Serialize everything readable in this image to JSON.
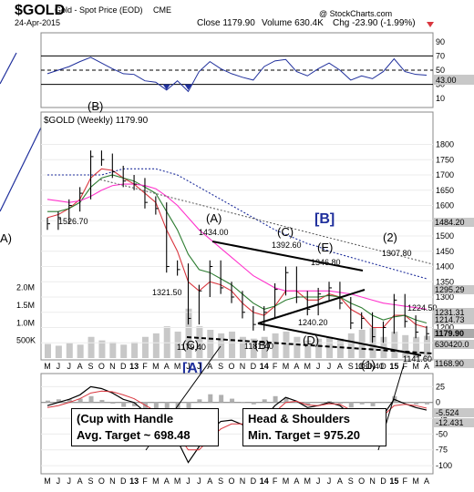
{
  "header": {
    "symbol": "$GOLD",
    "name": "Gold - Spot Price (EOD)",
    "exchange": "CME",
    "date": "24-Apr-2015",
    "close": "Close 1179.90",
    "volume": "Volume 630.4K",
    "change": "Chg -23.90 (-1.99%)",
    "watermark": "@ StockCharts.com"
  },
  "colors": {
    "price": "#000000",
    "ma_fast": "#d9363e",
    "ma_mid": "#2e7d32",
    "ma_pink": "#ff33cc",
    "ma_long": "#1f2f9c",
    "rsi": "#1f2f9c",
    "volume": "#c8c8c8",
    "label_box": "#c8c8c8"
  },
  "chart_data": [
    {
      "type": "line",
      "panel": "RSI",
      "yticks": [
        90,
        70,
        50,
        30,
        10
      ],
      "ylim": [
        0,
        100
      ],
      "levels": [
        70,
        50,
        30
      ],
      "last_value": "43.00",
      "x": [
        "2012-05",
        "2012-06",
        "2012-07",
        "2012-08",
        "2012-09",
        "2012-10",
        "2012-11",
        "2012-12",
        "2013-01",
        "2013-02",
        "2013-03",
        "2013-04",
        "2013-05",
        "2013-06",
        "2013-07",
        "2013-08",
        "2013-09",
        "2013-10",
        "2013-11",
        "2013-12",
        "2014-01",
        "2014-02",
        "2014-03",
        "2014-04",
        "2014-05",
        "2014-06",
        "2014-07",
        "2014-08",
        "2014-09",
        "2014-10",
        "2014-11",
        "2014-12",
        "2015-01",
        "2015-02",
        "2015-03",
        "2015-04"
      ],
      "values": [
        45,
        50,
        55,
        62,
        68,
        60,
        52,
        45,
        44,
        35,
        33,
        22,
        35,
        20,
        48,
        62,
        52,
        45,
        40,
        36,
        55,
        63,
        65,
        48,
        42,
        52,
        60,
        50,
        36,
        42,
        38,
        48,
        66,
        48,
        44,
        43
      ]
    },
    {
      "type": "line",
      "title": "$GOLD (Weekly) 1179.90",
      "panel": "price",
      "ylim": [
        1100,
        1900
      ],
      "yticks": [
        1800,
        1750,
        1700,
        1650,
        1600,
        1550,
        1500,
        1450,
        1400,
        1350,
        1300,
        1250,
        1200,
        1150
      ],
      "x": [
        "2012-05",
        "2012-06",
        "2012-07",
        "2012-08",
        "2012-09",
        "2012-10",
        "2012-11",
        "2012-12",
        "2013-01",
        "2013-02",
        "2013-03",
        "2013-04",
        "2013-05",
        "2013-06",
        "2013-07",
        "2013-08",
        "2013-09",
        "2013-10",
        "2013-11",
        "2013-12",
        "2014-01",
        "2014-02",
        "2014-03",
        "2014-04",
        "2014-05",
        "2014-06",
        "2014-07",
        "2014-08",
        "2014-09",
        "2014-10",
        "2014-11",
        "2014-12",
        "2015-01",
        "2015-02",
        "2015-03",
        "2015-04"
      ],
      "series": [
        {
          "values": [
            1540,
            1560,
            1600,
            1640,
            1760,
            1750,
            1710,
            1680,
            1670,
            1610,
            1590,
            1400,
            1390,
            1230,
            1320,
            1400,
            1330,
            1300,
            1250,
            1210,
            1250,
            1325,
            1380,
            1300,
            1260,
            1310,
            1330,
            1280,
            1215,
            1230,
            1170,
            1200,
            1290,
            1220,
            1185,
            1180
          ]
        },
        {
          "values": [
            1560,
            1570,
            1590,
            1620,
            1690,
            1720,
            1715,
            1690,
            1670,
            1640,
            1610,
            1520,
            1450,
            1350,
            1320,
            1350,
            1340,
            1320,
            1280,
            1250,
            1240,
            1270,
            1320,
            1320,
            1290,
            1290,
            1310,
            1300,
            1260,
            1240,
            1200,
            1200,
            1240,
            1240,
            1210,
            1200
          ]
        },
        {
          "values": [
            1580,
            1580,
            1590,
            1610,
            1660,
            1690,
            1700,
            1690,
            1680,
            1660,
            1640,
            1580,
            1520,
            1440,
            1390,
            1380,
            1360,
            1340,
            1310,
            1280,
            1260,
            1270,
            1290,
            1300,
            1300,
            1300,
            1305,
            1300,
            1280,
            1265,
            1240,
            1225,
            1235,
            1240,
            1225,
            1215
          ]
        },
        {
          "values": [
            1620,
            1615,
            1610,
            1615,
            1630,
            1650,
            1665,
            1670,
            1670,
            1665,
            1655,
            1630,
            1600,
            1560,
            1520,
            1490,
            1460,
            1430,
            1400,
            1370,
            1350,
            1330,
            1320,
            1320,
            1320,
            1320,
            1320,
            1315,
            1310,
            1300,
            1290,
            1280,
            1275,
            1270,
            1265,
            1260
          ]
        },
        {
          "values": [
            1700,
            1700,
            1700,
            1700,
            1700,
            1700,
            1710,
            1720,
            1720,
            1720,
            1720,
            1710,
            1700,
            1680,
            1660,
            1640,
            1620,
            1600,
            1580,
            1560,
            1540,
            1520,
            1505,
            1490,
            1475,
            1465,
            1450,
            1440,
            1430,
            1420,
            1410,
            1400,
            1390,
            1380,
            1370,
            1360
          ]
        }
      ],
      "price_labels": [
        "1526.70",
        "1434.00",
        "1392.60",
        "1346.80",
        "1321.50",
        "1307.80",
        "1240.20",
        "1224.50",
        "1179.40",
        "1181.40",
        "1130.40",
        "1141.60"
      ],
      "right_labels": [
        "1484.20",
        "1295.29",
        "1231.31",
        "1214.73",
        "1179.90",
        "630420.0",
        "1168.90"
      ],
      "wave_labels": [
        "(B)",
        "(A)",
        "(C)",
        "(E)",
        "(2)",
        "(C)",
        "(B)",
        "(D)",
        "(1)"
      ],
      "boxed_labels": [
        "[B]",
        "[A]"
      ]
    },
    {
      "type": "bar",
      "panel": "volume",
      "yticks": [
        "2.0M",
        "1.5M",
        "1.0M",
        "500K"
      ],
      "ylim": [
        0,
        2400000
      ],
      "values": [
        400000,
        350000,
        420000,
        380000,
        600000,
        500000,
        450000,
        380000,
        450000,
        600000,
        700000,
        900000,
        750000,
        1400000,
        900000,
        800000,
        700000,
        750000,
        600000,
        550000,
        600000,
        700000,
        750000,
        600000,
        500000,
        550000,
        600000,
        550000,
        700000,
        800000,
        850000,
        600000,
        750000,
        650000,
        600000,
        630420
      ]
    },
    {
      "type": "line",
      "panel": "MACD",
      "yticks": [
        25,
        0,
        -25,
        -50,
        -75,
        -100
      ],
      "ylim": [
        -110,
        40
      ],
      "last_values": [
        "-5.524",
        "-12.431"
      ],
      "values": [
        -5,
        0,
        5,
        12,
        25,
        22,
        15,
        5,
        0,
        -15,
        -25,
        -55,
        -60,
        -95,
        -70,
        -45,
        -30,
        -28,
        -35,
        -40,
        -25,
        -5,
        8,
        2,
        -8,
        -5,
        0,
        -5,
        -20,
        -18,
        -28,
        -20,
        5,
        -2,
        -8,
        -12
      ],
      "signal": [
        -8,
        -5,
        0,
        6,
        15,
        18,
        17,
        12,
        6,
        -4,
        -14,
        -35,
        -50,
        -75,
        -75,
        -58,
        -42,
        -34,
        -34,
        -37,
        -30,
        -15,
        0,
        2,
        -4,
        -5,
        -2,
        -3,
        -12,
        -15,
        -22,
        -21,
        -5,
        -3,
        -5,
        -9
      ]
    }
  ],
  "xaxis": {
    "labels": [
      "M",
      "J",
      "J",
      "A",
      "S",
      "O",
      "N",
      "D",
      "13",
      "F",
      "M",
      "A",
      "M",
      "J",
      "J",
      "A",
      "S",
      "O",
      "N",
      "D",
      "14",
      "F",
      "M",
      "A",
      "M",
      "J",
      "J",
      "A",
      "S",
      "O",
      "N",
      "D",
      "15",
      "F",
      "M",
      "A"
    ]
  },
  "annotations": {
    "left_paren": "A)",
    "cup_handle_line1": "(Cup with Handle",
    "cup_handle_line2": "Avg. Target ~ 698.48",
    "hs_line1": "Head & Shoulders",
    "hs_line2": "Min. Target = 975.20"
  }
}
